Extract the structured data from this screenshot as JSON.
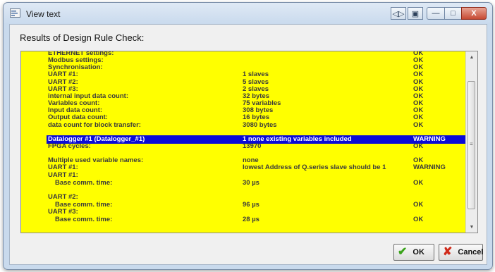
{
  "window": {
    "title": "View text",
    "controls": [
      "◁▷",
      "▣",
      "—",
      "□",
      "X"
    ]
  },
  "heading": "Results of Design Rule Check:",
  "rows": [
    {
      "label": "ETHERNET settings:",
      "value": "",
      "status": "OK"
    },
    {
      "label": "Modbus settings:",
      "value": "",
      "status": "OK"
    },
    {
      "label": "Synchronisation:",
      "value": "",
      "status": "OK"
    },
    {
      "label": "UART #1:",
      "value": "1 slaves",
      "status": "OK"
    },
    {
      "label": "UART #2:",
      "value": "5 slaves",
      "status": "OK"
    },
    {
      "label": "UART #3:",
      "value": "2 slaves",
      "status": "OK"
    },
    {
      "label": "internal input data count:",
      "value": "32 bytes",
      "status": "OK"
    },
    {
      "label": "Variables count:",
      "value": "75 variables",
      "status": "OK"
    },
    {
      "label": "Input data count:",
      "value": "308 bytes",
      "status": "OK"
    },
    {
      "label": "Output data count:",
      "value": "16 bytes",
      "status": "OK"
    },
    {
      "label": "data count for block transfer:",
      "value": "3080 bytes",
      "status": "OK"
    },
    {
      "label": "Datalogger #1 (Datalogger_#1)",
      "value": "1 none existing variables included",
      "status": "WARNING",
      "selected": true
    },
    {
      "label": "FPGA cycles:",
      "value": "13970",
      "status": "OK"
    },
    {
      "label": "Multiple used variable names:",
      "value": "none",
      "status": "OK"
    },
    {
      "label": "UART #1:",
      "value": "lowest Address of Q.series slave should be 1",
      "status": "WARNING"
    },
    {
      "label": "UART #1:",
      "value": "",
      "status": ""
    },
    {
      "label": "Base comm. time:",
      "value": "30 µs",
      "status": "OK",
      "indent": true
    },
    {
      "label": "UART #2:",
      "value": "",
      "status": ""
    },
    {
      "label": "Base comm. time:",
      "value": "96 µs",
      "status": "OK",
      "indent": true
    },
    {
      "label": "UART #3:",
      "value": "",
      "status": ""
    },
    {
      "label": "Base comm. time:",
      "value": "28 µs",
      "status": "OK",
      "indent": true
    }
  ],
  "buttons": {
    "ok": {
      "label": "OK",
      "icon": "checkmark-icon"
    },
    "cancel": {
      "label": "Cancel",
      "icon": "x-icon"
    }
  },
  "colors": {
    "panel_bg": "#ffff00",
    "selection_bg": "#0b0bd6"
  }
}
